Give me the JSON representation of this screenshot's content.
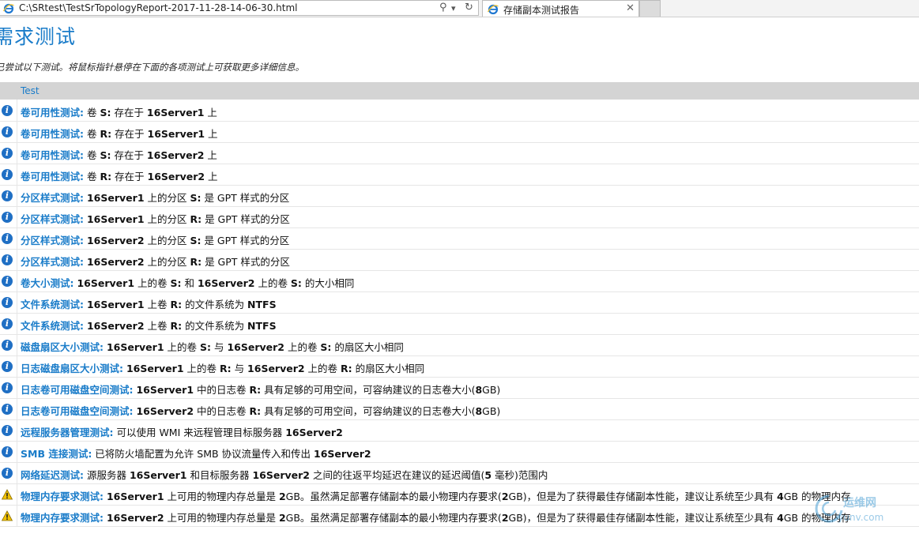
{
  "browser": {
    "url": "C:\\SRtest\\TestSrTopologyReport-2017-11-28-14-06-30.html",
    "tab_title": "存储副本测试报告",
    "search_glyph": "⚲",
    "dropdown_glyph": "▾",
    "refresh_glyph": "↻",
    "close_glyph": "✕"
  },
  "page": {
    "title": "需求测试",
    "description": "已尝试以下测试。将鼠标指针悬停在下面的各项测试上可获取更多详细信息。",
    "column_header": "Test"
  },
  "rows": [
    {
      "status": "info",
      "segments": [
        {
          "t": "卷可用性测试:",
          "s": "label"
        },
        {
          "t": " 卷 "
        },
        {
          "t": "S:",
          "s": "bold"
        },
        {
          "t": " 存在于 "
        },
        {
          "t": "16Server1",
          "s": "bold"
        },
        {
          "t": " 上"
        }
      ]
    },
    {
      "status": "info",
      "segments": [
        {
          "t": "卷可用性测试:",
          "s": "label"
        },
        {
          "t": " 卷 "
        },
        {
          "t": "R:",
          "s": "bold"
        },
        {
          "t": " 存在于 "
        },
        {
          "t": "16Server1",
          "s": "bold"
        },
        {
          "t": " 上"
        }
      ]
    },
    {
      "status": "info",
      "segments": [
        {
          "t": "卷可用性测试:",
          "s": "label"
        },
        {
          "t": " 卷 "
        },
        {
          "t": "S:",
          "s": "bold"
        },
        {
          "t": " 存在于 "
        },
        {
          "t": "16Server2",
          "s": "bold"
        },
        {
          "t": " 上"
        }
      ]
    },
    {
      "status": "info",
      "segments": [
        {
          "t": "卷可用性测试:",
          "s": "label"
        },
        {
          "t": " 卷 "
        },
        {
          "t": "R:",
          "s": "bold"
        },
        {
          "t": " 存在于 "
        },
        {
          "t": "16Server2",
          "s": "bold"
        },
        {
          "t": " 上"
        }
      ]
    },
    {
      "status": "info",
      "segments": [
        {
          "t": "分区样式测试:",
          "s": "label"
        },
        {
          "t": " "
        },
        {
          "t": "16Server1",
          "s": "bold"
        },
        {
          "t": " 上的分区 "
        },
        {
          "t": "S:",
          "s": "bold"
        },
        {
          "t": " 是 GPT 样式的分区"
        }
      ]
    },
    {
      "status": "info",
      "segments": [
        {
          "t": "分区样式测试:",
          "s": "label"
        },
        {
          "t": " "
        },
        {
          "t": "16Server1",
          "s": "bold"
        },
        {
          "t": " 上的分区 "
        },
        {
          "t": "R:",
          "s": "bold"
        },
        {
          "t": " 是 GPT 样式的分区"
        }
      ]
    },
    {
      "status": "info",
      "segments": [
        {
          "t": "分区样式测试:",
          "s": "label"
        },
        {
          "t": " "
        },
        {
          "t": "16Server2",
          "s": "bold"
        },
        {
          "t": " 上的分区 "
        },
        {
          "t": "S:",
          "s": "bold"
        },
        {
          "t": " 是 GPT 样式的分区"
        }
      ]
    },
    {
      "status": "info",
      "segments": [
        {
          "t": "分区样式测试:",
          "s": "label"
        },
        {
          "t": " "
        },
        {
          "t": "16Server2",
          "s": "bold"
        },
        {
          "t": " 上的分区 "
        },
        {
          "t": "R:",
          "s": "bold"
        },
        {
          "t": " 是 GPT 样式的分区"
        }
      ]
    },
    {
      "status": "info",
      "segments": [
        {
          "t": "卷大小测试:",
          "s": "label"
        },
        {
          "t": " "
        },
        {
          "t": "16Server1",
          "s": "bold"
        },
        {
          "t": " 上的卷 "
        },
        {
          "t": "S:",
          "s": "bold"
        },
        {
          "t": " 和 "
        },
        {
          "t": "16Server2",
          "s": "bold"
        },
        {
          "t": " 上的卷 "
        },
        {
          "t": "S:",
          "s": "bold"
        },
        {
          "t": " 的大小相同"
        }
      ]
    },
    {
      "status": "info",
      "segments": [
        {
          "t": "文件系统测试:",
          "s": "label"
        },
        {
          "t": " "
        },
        {
          "t": "16Server1",
          "s": "bold"
        },
        {
          "t": " 上卷 "
        },
        {
          "t": "R:",
          "s": "bold"
        },
        {
          "t": " 的文件系统为 "
        },
        {
          "t": "NTFS",
          "s": "bold"
        }
      ]
    },
    {
      "status": "info",
      "segments": [
        {
          "t": "文件系统测试:",
          "s": "label"
        },
        {
          "t": " "
        },
        {
          "t": "16Server2",
          "s": "bold"
        },
        {
          "t": " 上卷 "
        },
        {
          "t": "R:",
          "s": "bold"
        },
        {
          "t": " 的文件系统为 "
        },
        {
          "t": "NTFS",
          "s": "bold"
        }
      ]
    },
    {
      "status": "info",
      "segments": [
        {
          "t": "磁盘扇区大小测试:",
          "s": "label"
        },
        {
          "t": " "
        },
        {
          "t": "16Server1",
          "s": "bold"
        },
        {
          "t": " 上的卷 "
        },
        {
          "t": "S:",
          "s": "bold"
        },
        {
          "t": " 与 "
        },
        {
          "t": "16Server2",
          "s": "bold"
        },
        {
          "t": " 上的卷 "
        },
        {
          "t": "S:",
          "s": "bold"
        },
        {
          "t": " 的扇区大小相同"
        }
      ]
    },
    {
      "status": "info",
      "segments": [
        {
          "t": "日志磁盘扇区大小测试:",
          "s": "label"
        },
        {
          "t": " "
        },
        {
          "t": "16Server1",
          "s": "bold"
        },
        {
          "t": " 上的卷 "
        },
        {
          "t": "R:",
          "s": "bold"
        },
        {
          "t": " 与 "
        },
        {
          "t": "16Server2",
          "s": "bold"
        },
        {
          "t": " 上的卷 "
        },
        {
          "t": "R:",
          "s": "bold"
        },
        {
          "t": " 的扇区大小相同"
        }
      ]
    },
    {
      "status": "info",
      "segments": [
        {
          "t": "日志卷可用磁盘空间测试:",
          "s": "label"
        },
        {
          "t": " "
        },
        {
          "t": "16Server1",
          "s": "bold"
        },
        {
          "t": " 中的日志卷 "
        },
        {
          "t": "R:",
          "s": "bold"
        },
        {
          "t": " 具有足够的可用空间，可容纳建议的日志卷大小("
        },
        {
          "t": "8",
          "s": "bold"
        },
        {
          "t": "GB)"
        }
      ]
    },
    {
      "status": "info",
      "segments": [
        {
          "t": "日志卷可用磁盘空间测试:",
          "s": "label"
        },
        {
          "t": " "
        },
        {
          "t": "16Server2",
          "s": "bold"
        },
        {
          "t": " 中的日志卷 "
        },
        {
          "t": "R:",
          "s": "bold"
        },
        {
          "t": " 具有足够的可用空间，可容纳建议的日志卷大小("
        },
        {
          "t": "8",
          "s": "bold"
        },
        {
          "t": "GB)"
        }
      ]
    },
    {
      "status": "info",
      "segments": [
        {
          "t": "远程服务器管理测试:",
          "s": "label"
        },
        {
          "t": " 可以使用 WMI 来远程管理目标服务器 "
        },
        {
          "t": "16Server2",
          "s": "bold"
        }
      ]
    },
    {
      "status": "info",
      "segments": [
        {
          "t": "SMB 连接测试:",
          "s": "label"
        },
        {
          "t": " 已将防火墙配置为允许 SMB 协议流量传入和传出 "
        },
        {
          "t": "16Server2",
          "s": "bold"
        }
      ]
    },
    {
      "status": "info",
      "segments": [
        {
          "t": "网络延迟测试:",
          "s": "label"
        },
        {
          "t": " 源服务器 "
        },
        {
          "t": "16Server1",
          "s": "bold"
        },
        {
          "t": " 和目标服务器 "
        },
        {
          "t": "16Server2",
          "s": "bold"
        },
        {
          "t": " 之间的往返平均延迟在建议的延迟阈值("
        },
        {
          "t": "5",
          "s": "bold"
        },
        {
          "t": " 毫秒)范围内"
        }
      ]
    },
    {
      "status": "warning",
      "segments": [
        {
          "t": "物理内存要求测试:",
          "s": "label"
        },
        {
          "t": " "
        },
        {
          "t": "16Server1",
          "s": "bold"
        },
        {
          "t": " 上可用的物理内存总量是 "
        },
        {
          "t": "2",
          "s": "bold"
        },
        {
          "t": "GB。虽然满足部署存储副本的最小物理内存要求("
        },
        {
          "t": "2",
          "s": "bold"
        },
        {
          "t": "GB)，但是为了获得最佳存储副本性能，建议让系统至少具有 "
        },
        {
          "t": "4",
          "s": "bold"
        },
        {
          "t": "GB 的物理内存"
        }
      ]
    },
    {
      "status": "warning",
      "segments": [
        {
          "t": "物理内存要求测试:",
          "s": "label"
        },
        {
          "t": " "
        },
        {
          "t": "16Server2",
          "s": "bold"
        },
        {
          "t": " 上可用的物理内存总量是 "
        },
        {
          "t": "2",
          "s": "bold"
        },
        {
          "t": "GB。虽然满足部署存储副本的最小物理内存要求("
        },
        {
          "t": "2",
          "s": "bold"
        },
        {
          "t": "GB)，但是为了获得最佳存储副本性能，建议让系统至少具有 "
        },
        {
          "t": "4",
          "s": "bold"
        },
        {
          "t": "GB 的物理内存"
        }
      ]
    }
  ],
  "watermark": {
    "line1": "运维网",
    "line2": "iyunv.com"
  },
  "colors": {
    "accent": "#1a7cc9",
    "info_icon": "#1f6fc4",
    "warning_icon": "#f2c200",
    "header_bg": "#d4d4d4"
  }
}
